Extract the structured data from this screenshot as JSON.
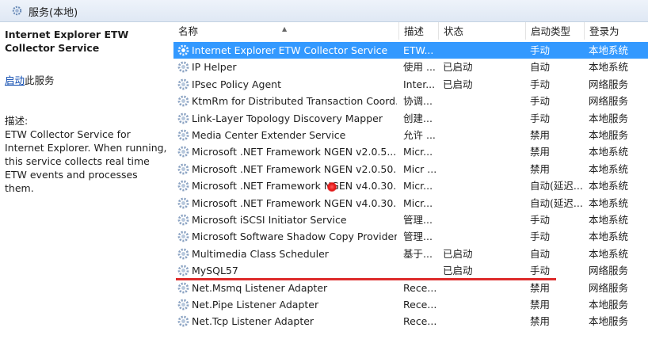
{
  "window": {
    "title": "服务(本地)",
    "icon": "gear-search-icon"
  },
  "detail": {
    "service_name": "Internet Explorer ETW Collector Service",
    "start_link": "启动",
    "start_suffix": "此服务",
    "desc_label": "描述:",
    "description": "ETW Collector Service for Internet Explorer. When running, this service collects real time ETW events and processes them."
  },
  "columns": {
    "name": "名称",
    "desc": "描述",
    "status": "状态",
    "startup": "启动类型",
    "logon": "登录为"
  },
  "services": [
    {
      "name": "Internet Explorer ETW Collector Service",
      "desc": "ETW...",
      "status": "",
      "startup": "手动",
      "logon": "本地系统"
    },
    {
      "name": "IP Helper",
      "desc": "使用 ...",
      "status": "已启动",
      "startup": "自动",
      "logon": "本地系统"
    },
    {
      "name": "IPsec Policy Agent",
      "desc": "Inter...",
      "status": "已启动",
      "startup": "手动",
      "logon": "网络服务"
    },
    {
      "name": "KtmRm for Distributed Transaction Coord...",
      "desc": "协调...",
      "status": "",
      "startup": "手动",
      "logon": "网络服务"
    },
    {
      "name": "Link-Layer Topology Discovery Mapper",
      "desc": "创建...",
      "status": "",
      "startup": "手动",
      "logon": "本地服务"
    },
    {
      "name": "Media Center Extender Service",
      "desc": "允许 ...",
      "status": "",
      "startup": "禁用",
      "logon": "本地服务"
    },
    {
      "name": "Microsoft .NET Framework NGEN v2.0.5...",
      "desc": "Micr...",
      "status": "",
      "startup": "禁用",
      "logon": "本地系统"
    },
    {
      "name": "Microsoft .NET Framework NGEN v2.0.50...",
      "desc": "Micr ...",
      "status": "",
      "startup": "禁用",
      "logon": "本地系统"
    },
    {
      "name": "Microsoft .NET Framework NGEN v4.0.30...",
      "desc": "Micr...",
      "status": "",
      "startup": "自动(延迟...",
      "logon": "本地系统"
    },
    {
      "name": "Microsoft .NET Framework NGEN v4.0.30...",
      "desc": "Micr...",
      "status": "",
      "startup": "自动(延迟...",
      "logon": "本地系统"
    },
    {
      "name": "Microsoft iSCSI Initiator Service",
      "desc": "管理...",
      "status": "",
      "startup": "手动",
      "logon": "本地系统"
    },
    {
      "name": "Microsoft Software Shadow Copy Provider",
      "desc": "管理...",
      "status": "",
      "startup": "手动",
      "logon": "本地系统"
    },
    {
      "name": "Multimedia Class Scheduler",
      "desc": "基于...",
      "status": "已启动",
      "startup": "自动",
      "logon": "本地系统"
    },
    {
      "name": "MySQL57",
      "desc": "",
      "status": "已启动",
      "startup": "手动",
      "logon": "网络服务"
    },
    {
      "name": "Net.Msmq Listener Adapter",
      "desc": "Rece...",
      "status": "",
      "startup": "禁用",
      "logon": "网络服务"
    },
    {
      "name": "Net.Pipe Listener Adapter",
      "desc": "Rece...",
      "status": "",
      "startup": "禁用",
      "logon": "本地服务"
    },
    {
      "name": "Net.Tcp Listener Adapter",
      "desc": "Rece...",
      "status": "",
      "startup": "禁用",
      "logon": "本地服务"
    }
  ],
  "colors": {
    "selection": "#3399ff",
    "annotation_underline": "#dd2b2b",
    "link": "#0645ad"
  }
}
